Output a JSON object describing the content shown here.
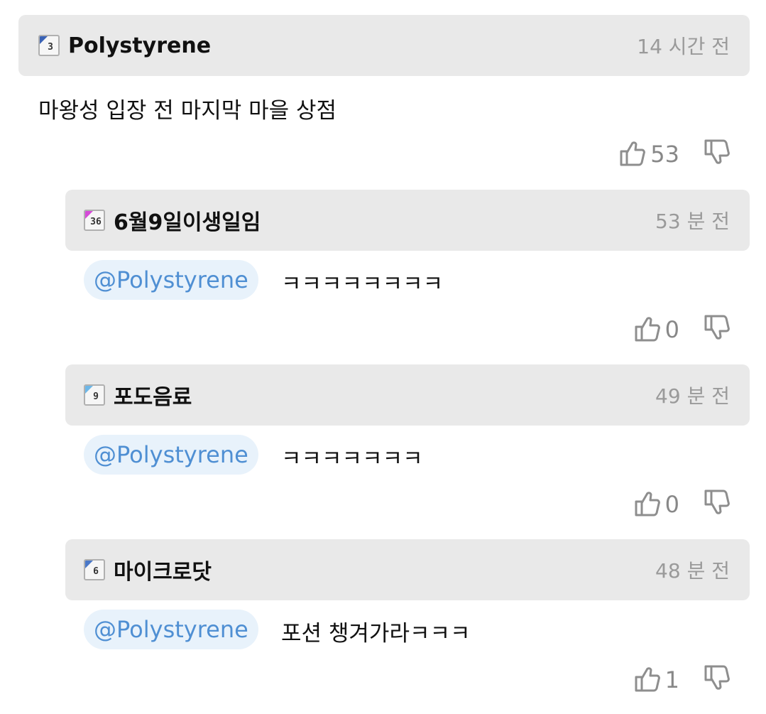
{
  "comments": [
    {
      "level": "3",
      "level_color": "#3a62b5",
      "author": "Polystyrene",
      "time": "14 시간 전",
      "mention": "",
      "text": "마왕성 입장 전 마지막 마을 상점",
      "likes": "53",
      "like_icon": "thumbs-up-icon",
      "dislike_icon": "thumbs-down-icon"
    },
    {
      "level": "36",
      "level_color": "#d54ad8",
      "author": "6월9일이생일임",
      "time": "53 분 전",
      "mention": "@Polystyrene",
      "text": "ㅋㅋㅋㅋㅋㅋㅋㅋ",
      "likes": "0",
      "like_icon": "thumbs-up-icon",
      "dislike_icon": "thumbs-down-icon"
    },
    {
      "level": "9",
      "level_color": "#6db7e8",
      "author": "포도음료",
      "time": "49 분 전",
      "mention": "@Polystyrene",
      "text": "ㅋㅋㅋㅋㅋㅋㅋ",
      "likes": "0",
      "like_icon": "thumbs-up-icon",
      "dislike_icon": "thumbs-down-icon"
    },
    {
      "level": "6",
      "level_color": "#4a78c8",
      "author": "마이크로닷",
      "time": "48 분 전",
      "mention": "@Polystyrene",
      "text": "포션 챙겨가라ㅋㅋㅋ",
      "likes": "1",
      "like_icon": "thumbs-up-icon",
      "dislike_icon": "thumbs-down-icon"
    }
  ]
}
